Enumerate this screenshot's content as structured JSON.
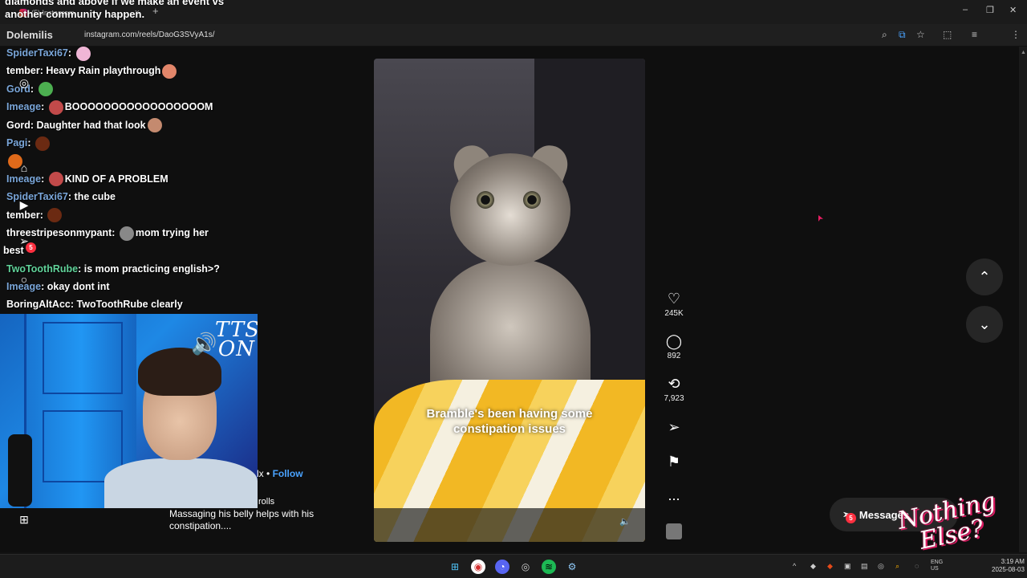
{
  "browser": {
    "tab_title": "(5) Instagram",
    "url": "instagram.com/reels/DaoG3SVyA1s/"
  },
  "stream": {
    "chat_top": "diamonds and above if we make an event vs another community happen.",
    "streamer_name": "Dolemilis",
    "tts_text": "TTS ON",
    "chat": [
      {
        "user": "SpiderTaxi67",
        "user_color": "#7aa6d9",
        "text": "",
        "emote": "#f0b6d6"
      },
      {
        "user": "tember",
        "user_color": "#ffffff",
        "text": "Heavy Rain playthrough",
        "emote": "#e2866a"
      },
      {
        "user": "Gord",
        "user_color": "#7aa6d9",
        "text": "",
        "emote": "#4caf50"
      },
      {
        "user": "Imeage",
        "user_color": "#7aa6d9",
        "text": "BOOOOOOOOOOOOOOOOOM",
        "emote_before": "#c24a4a"
      },
      {
        "user": "Gord",
        "user_color": "#ffffff",
        "text": "Daughter had that look",
        "emote": "#c48a6f"
      },
      {
        "user": "Pagi",
        "user_color": "#7aa6d9",
        "text": "",
        "emote": "#6b2a12"
      },
      {
        "user": "",
        "user_color": "#ffffff",
        "text": "",
        "emote": "#e06a1a"
      },
      {
        "user": "Imeage",
        "user_color": "#7aa6d9",
        "text": "KIND OF A PROBLEM",
        "emote_before": "#c24a4a"
      },
      {
        "user": "SpiderTaxi67",
        "user_color": "#7aa6d9",
        "text": "the cube"
      },
      {
        "user": "tember",
        "user_color": "#ffffff",
        "text": "",
        "emote": "#6b2a12"
      },
      {
        "user": "threestripesonmypant",
        "user_color": "#ffffff",
        "text": "mom trying her",
        "emote_before": "#888888"
      },
      {
        "user": "",
        "user_color": "#ffffff",
        "text": "best"
      },
      {
        "user": "TwoToothRube",
        "user_color": "#61d39a",
        "text": "is mom practicing english>?"
      },
      {
        "user": "Imeage",
        "user_color": "#7aa6d9",
        "text": "okay dont int"
      },
      {
        "user": "BoringAltAcc",
        "user_color": "#ffffff",
        "text": "TwoToothRube clearly"
      }
    ],
    "overlay_brand": "Nothing Else?"
  },
  "sidebar": {
    "notification_count": "5",
    "icons": [
      "instagram-icon",
      "home-icon",
      "reels-icon",
      "messages-icon",
      "search-icon",
      "more-icon"
    ]
  },
  "reel": {
    "caption_overlay": "Bramble's been having some constipation issues",
    "author_suffix": "lx",
    "follow_label": "Follow",
    "separator": "•",
    "rolls_text": "rolls",
    "description": "Massaging his belly helps with his constipation....",
    "likes": "245K",
    "comments": "892",
    "reposts": "7,923",
    "more": "..."
  },
  "messages": {
    "label": "Messages",
    "count": "5"
  },
  "taskbar": {
    "lang1": "ENG",
    "lang2": "US",
    "time": "3:19 AM",
    "date": "2025-08-03"
  }
}
